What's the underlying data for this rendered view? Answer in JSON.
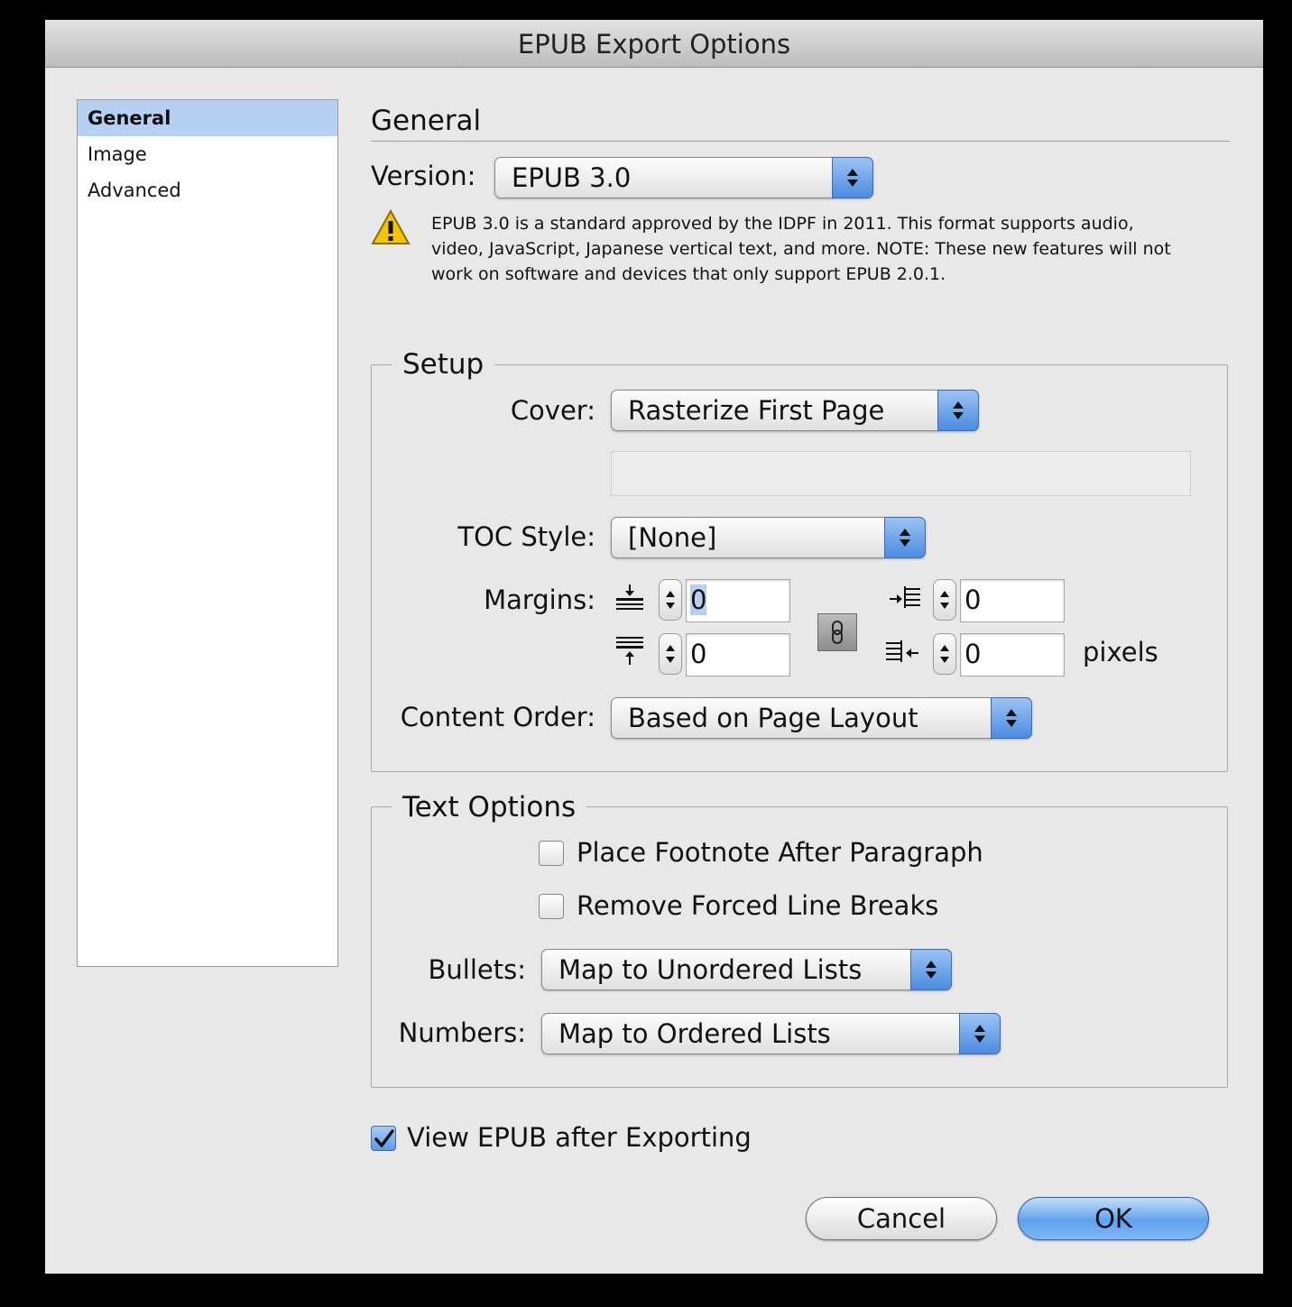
{
  "window": {
    "title": "EPUB Export Options"
  },
  "sidebar": {
    "items": [
      {
        "label": "General",
        "selected": true
      },
      {
        "label": "Image",
        "selected": false
      },
      {
        "label": "Advanced",
        "selected": false
      }
    ]
  },
  "general": {
    "heading": "General",
    "version_label": "Version:",
    "version_value": "EPUB 3.0",
    "warning_lines": [
      "EPUB 3.0 is a standard approved by the IDPF in 2011. This format supports audio,",
      "video, JavaScript, Japanese vertical text, and more. NOTE: These new features will not",
      "work on software and devices that only support EPUB 2.0.1."
    ]
  },
  "setup": {
    "title": "Setup",
    "cover_label": "Cover:",
    "cover_value": "Rasterize First Page",
    "cover_path": "",
    "toc_label": "TOC Style:",
    "toc_value": "[None]",
    "margins_label": "Margins:",
    "margin_top": "0",
    "margin_bottom": "0",
    "margin_left": "0",
    "margin_right": "0",
    "units": "pixels",
    "content_order_label": "Content Order:",
    "content_order_value": "Based on Page Layout"
  },
  "text_options": {
    "title": "Text Options",
    "footnote_label": "Place Footnote After Paragraph",
    "footnote_checked": false,
    "linebreaks_label": "Remove Forced Line Breaks",
    "linebreaks_checked": false,
    "bullets_label": "Bullets:",
    "bullets_value": "Map to Unordered Lists",
    "numbers_label": "Numbers:",
    "numbers_value": "Map to Ordered Lists"
  },
  "view_after": {
    "label": "View EPUB after Exporting",
    "checked": true
  },
  "buttons": {
    "cancel": "Cancel",
    "ok": "OK"
  },
  "colors": {
    "accent": "#5e9ae6",
    "selection": "#b6d0f2",
    "warning": "#f5c400"
  }
}
